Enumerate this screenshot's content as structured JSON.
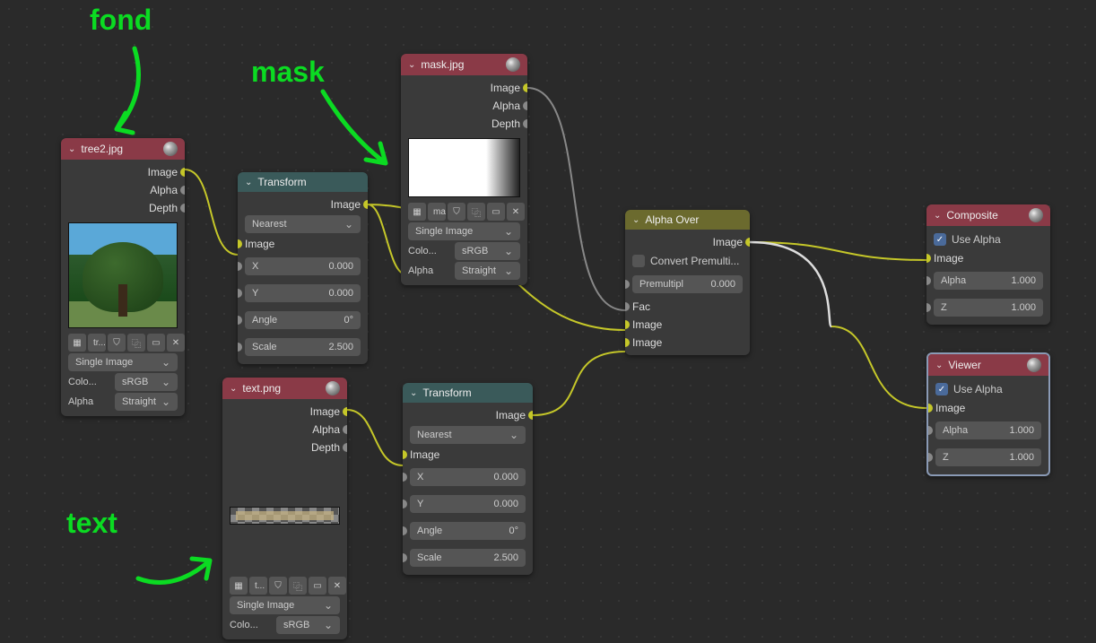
{
  "annotations": {
    "fond": "fond",
    "mask": "mask",
    "text": "text"
  },
  "nodes": {
    "tree_image": {
      "title": "tree2.jpg",
      "outputs": {
        "image": "Image",
        "alpha": "Alpha",
        "depth": "Depth"
      },
      "file_short": "tr...",
      "source": "Single Image",
      "color_label": "Colo...",
      "color_value": "sRGB",
      "alpha_label": "Alpha",
      "alpha_value": "Straight"
    },
    "transform1": {
      "title": "Transform",
      "output": "Image",
      "filter": "Nearest",
      "input": "Image",
      "x": {
        "label": "X",
        "value": "0.000"
      },
      "y": {
        "label": "Y",
        "value": "0.000"
      },
      "angle": {
        "label": "Angle",
        "value": "0°"
      },
      "scale": {
        "label": "Scale",
        "value": "2.500"
      }
    },
    "mask_image": {
      "title": "mask.jpg",
      "outputs": {
        "image": "Image",
        "alpha": "Alpha",
        "depth": "Depth"
      },
      "file_short": "ma",
      "source": "Single Image",
      "color_label": "Colo...",
      "color_value": "sRGB",
      "alpha_label": "Alpha",
      "alpha_value": "Straight"
    },
    "text_image": {
      "title": "text.png",
      "outputs": {
        "image": "Image",
        "alpha": "Alpha",
        "depth": "Depth"
      },
      "file_short": "t...",
      "source": "Single Image",
      "color_label": "Colo...",
      "color_value": "sRGB"
    },
    "transform2": {
      "title": "Transform",
      "output": "Image",
      "filter": "Nearest",
      "input": "Image",
      "x": {
        "label": "X",
        "value": "0.000"
      },
      "y": {
        "label": "Y",
        "value": "0.000"
      },
      "angle": {
        "label": "Angle",
        "value": "0°"
      },
      "scale": {
        "label": "Scale",
        "value": "2.500"
      }
    },
    "alpha_over": {
      "title": "Alpha Over",
      "output": "Image",
      "convert": "Convert Premulti...",
      "premul": {
        "label": "Premultipl",
        "value": "0.000"
      },
      "inputs": {
        "fac": "Fac",
        "image1": "Image",
        "image2": "Image"
      }
    },
    "composite": {
      "title": "Composite",
      "use_alpha": "Use Alpha",
      "inputs": {
        "image": "Image",
        "alpha": {
          "label": "Alpha",
          "value": "1.000"
        },
        "z": {
          "label": "Z",
          "value": "1.000"
        }
      }
    },
    "viewer": {
      "title": "Viewer",
      "use_alpha": "Use Alpha",
      "inputs": {
        "image": "Image",
        "alpha": {
          "label": "Alpha",
          "value": "1.000"
        },
        "z": {
          "label": "Z",
          "value": "1.000"
        }
      }
    }
  }
}
